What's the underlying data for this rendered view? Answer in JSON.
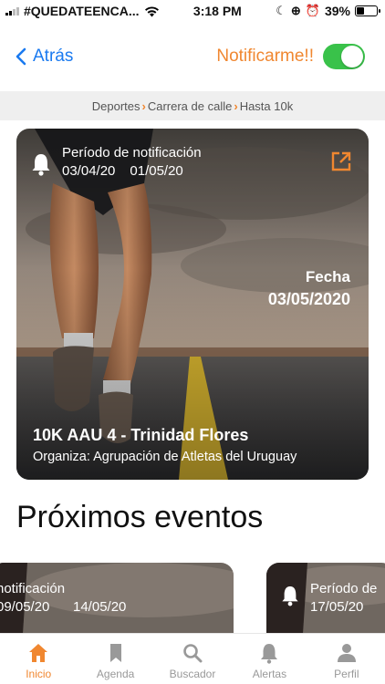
{
  "status_bar": {
    "carrier": "#QUEDATEENCA...",
    "time": "3:18 PM",
    "battery": "39%",
    "battery_level": 0.39
  },
  "nav": {
    "back_label": "Atrás",
    "notify_label": "Notificarme!!",
    "notify_on": true
  },
  "breadcrumb": {
    "items": [
      "Deportes",
      "Carrera de calle",
      "Hasta 10k"
    ]
  },
  "featured": {
    "notif_label": "Período de notificación",
    "notif_start": "03/04/20",
    "notif_end": "01/05/20",
    "fecha_label": "Fecha",
    "fecha_value": "03/05/2020",
    "title": "10K AAU 4 - Trinidad Flores",
    "organizer": "Organiza: Agrupación de Atletas del Uruguay"
  },
  "upcoming": {
    "title": "Próximos eventos",
    "cards": [
      {
        "label": "notificación",
        "start": "09/05/20",
        "end": "14/05/20"
      },
      {
        "label": "Período de",
        "start": "17/05/20"
      }
    ]
  },
  "tabs": [
    {
      "label": "Inicio",
      "icon": "home-icon",
      "active": true
    },
    {
      "label": "Agenda",
      "icon": "bookmark-icon",
      "active": false
    },
    {
      "label": "Buscador",
      "icon": "search-icon",
      "active": false
    },
    {
      "label": "Alertas",
      "icon": "bell-icon",
      "active": false
    },
    {
      "label": "Perfil",
      "icon": "user-icon",
      "active": false
    }
  ],
  "colors": {
    "accent": "#f08730",
    "link": "#1a7af0",
    "toggle_on": "#39c24a"
  }
}
